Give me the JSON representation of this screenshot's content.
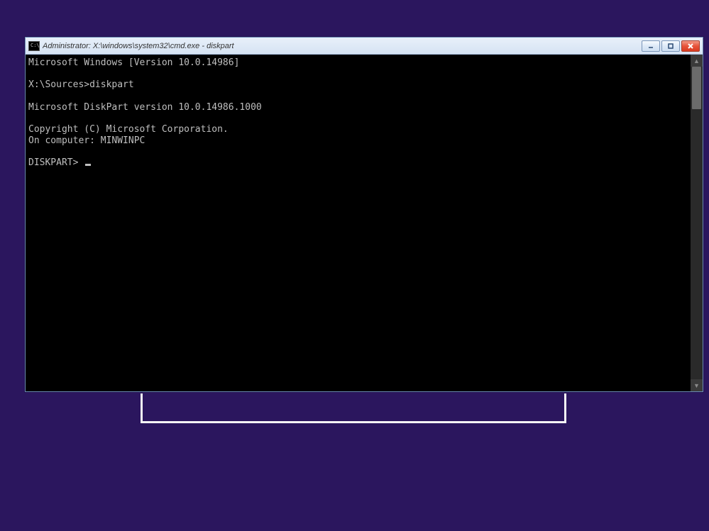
{
  "window": {
    "title": "Administrator: X:\\windows\\system32\\cmd.exe - diskpart",
    "icon_label": "cmd-icon"
  },
  "terminal": {
    "lines": [
      "Microsoft Windows [Version 10.0.14986]",
      "",
      "X:\\Sources>diskpart",
      "",
      "Microsoft DiskPart version 10.0.14986.1000",
      "",
      "Copyright (C) Microsoft Corporation.",
      "On computer: MINWINPC",
      "",
      "DISKPART> "
    ]
  },
  "controls": {
    "minimize_label": "Minimize",
    "maximize_label": "Maximize",
    "close_label": "Close"
  }
}
